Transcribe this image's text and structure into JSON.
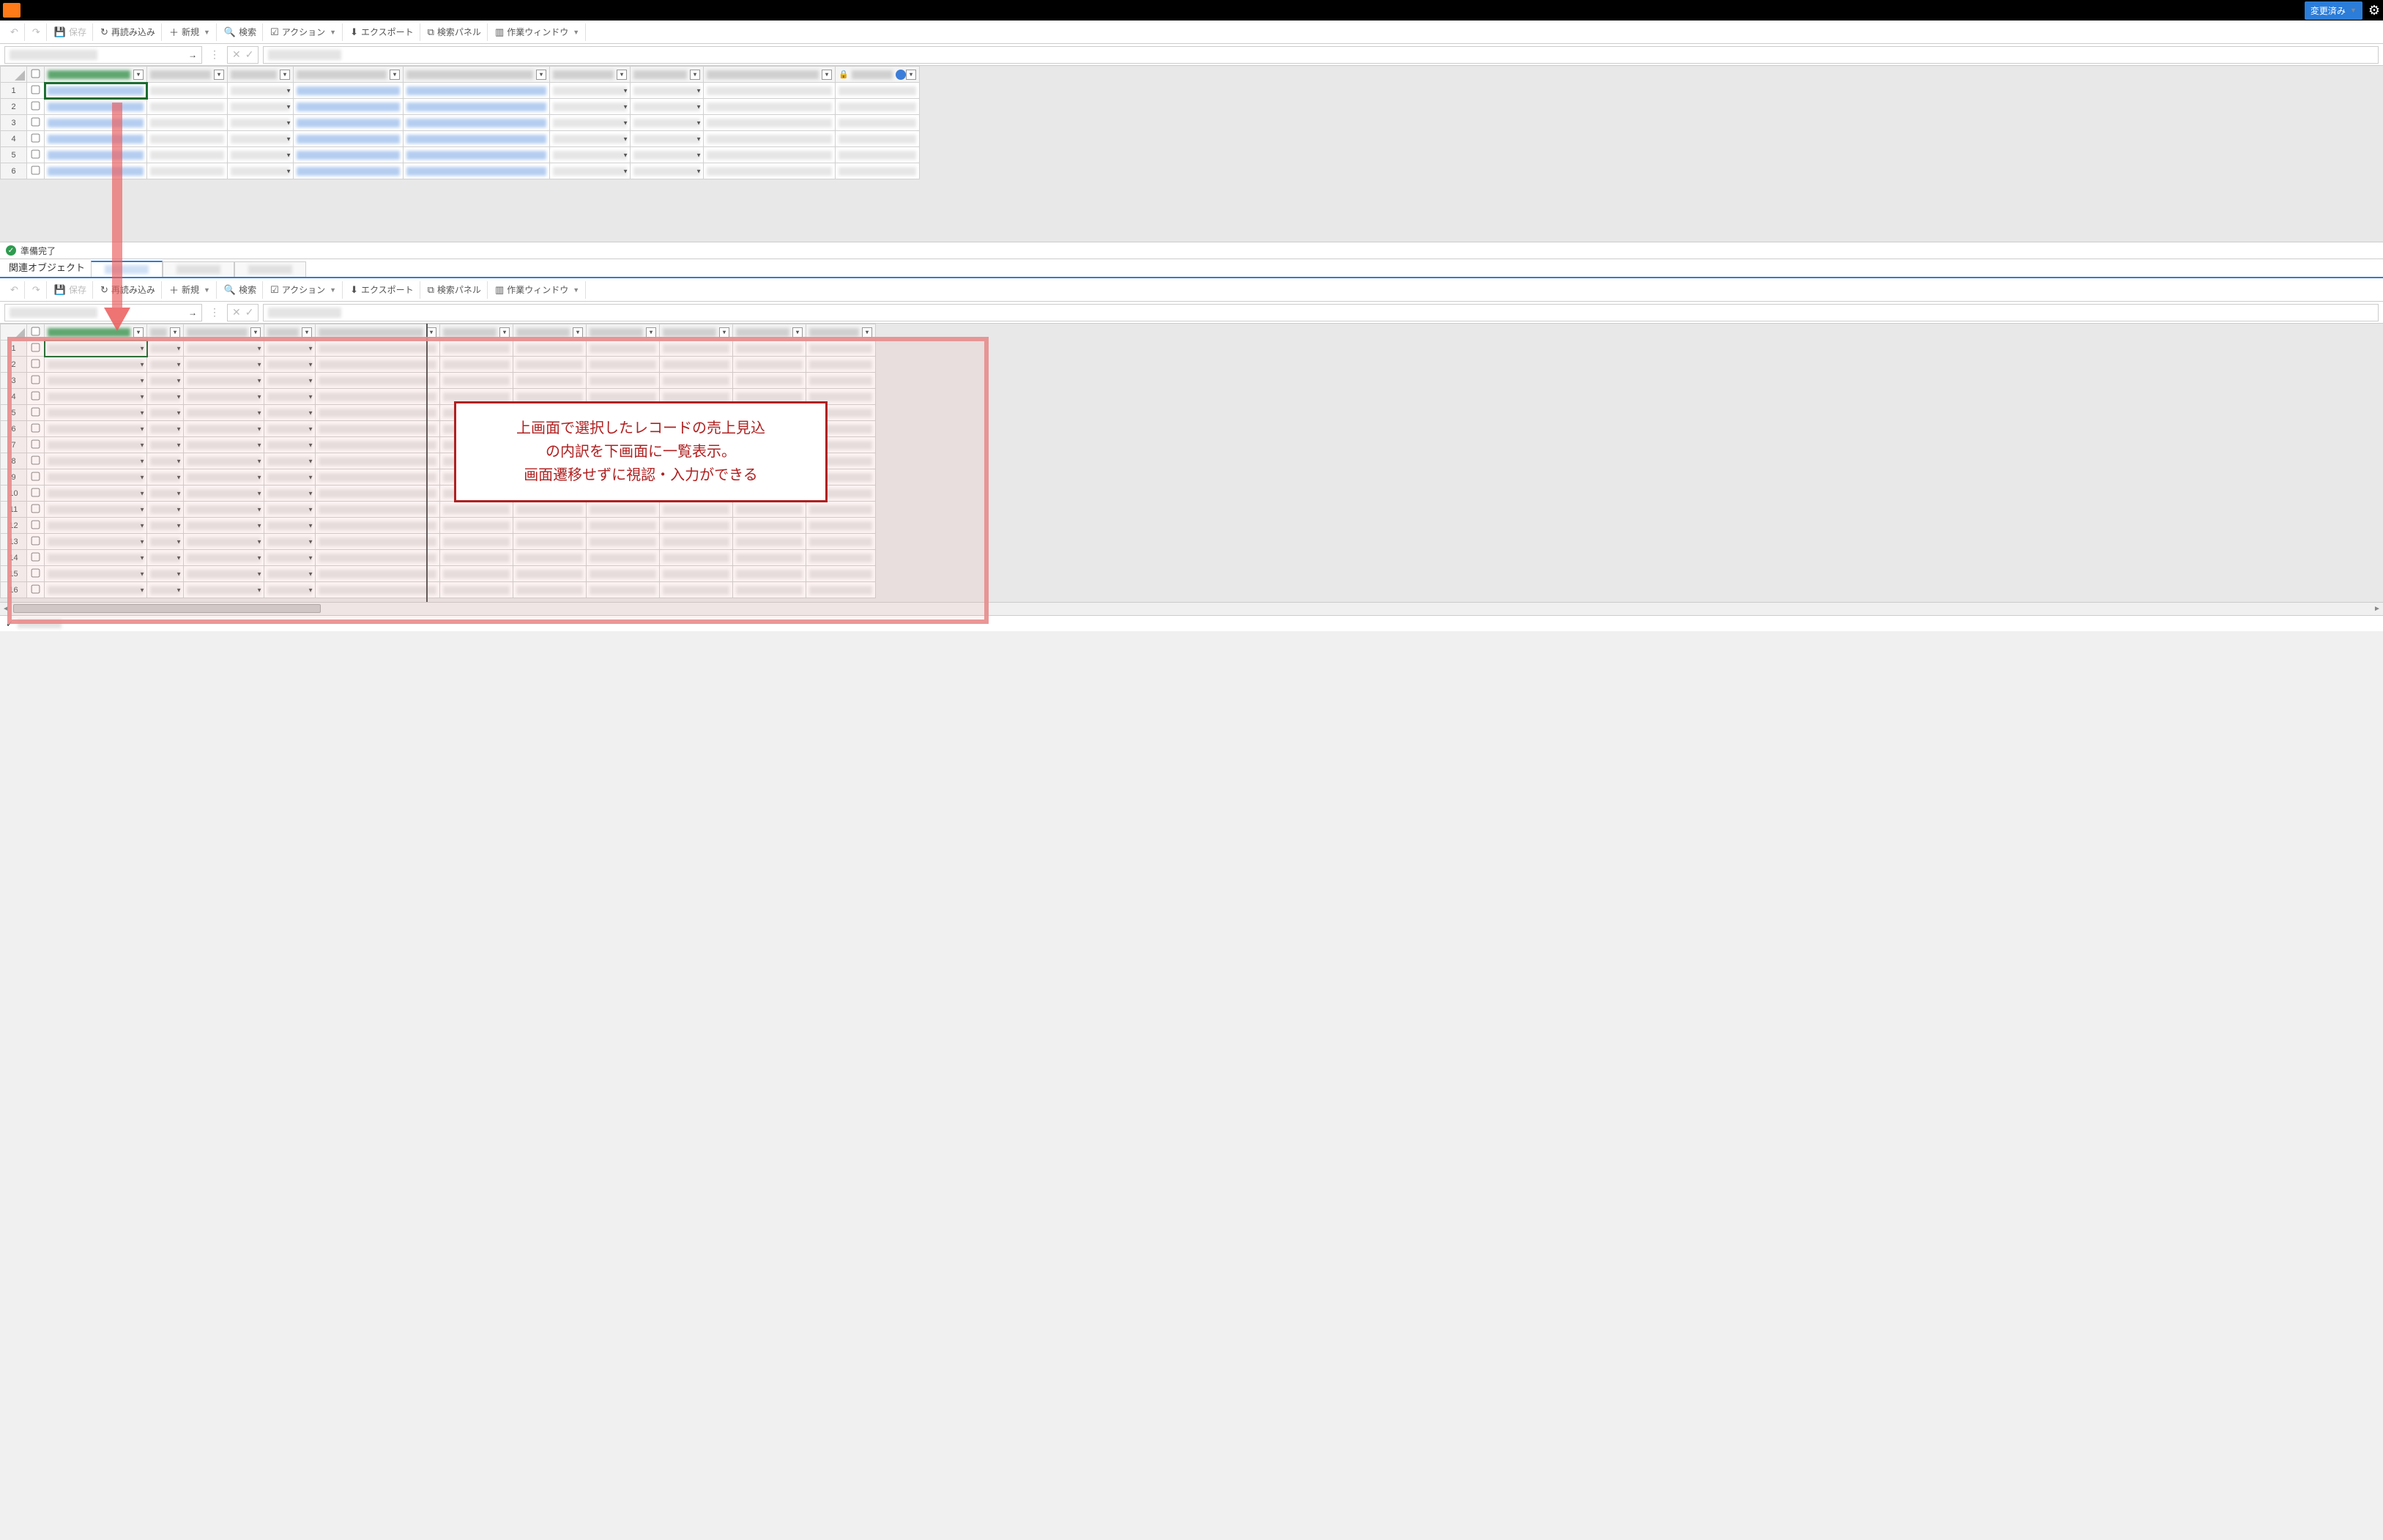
{
  "titlebar": {
    "changed_label": "変更済み"
  },
  "toolbar": {
    "save": "保存",
    "reload": "再読み込み",
    "new": "新規",
    "search": "検索",
    "action": "アクション",
    "export": "エクスポート",
    "search_panel": "検索パネル",
    "work_window": "作業ウィンドウ"
  },
  "status": {
    "ready": "準備完了"
  },
  "related": {
    "label": "関連オブジェクト"
  },
  "callout": {
    "line1": "上画面で選択したレコードの売上見込",
    "line2": "の内訳を下画面に一覧表示。",
    "line3": "画面遷移せずに視認・入力ができる"
  },
  "top_grid": {
    "rows": [
      1,
      2,
      3,
      4,
      5,
      6
    ],
    "col_count": 9,
    "dropdown_cols": [
      2,
      5,
      6
    ],
    "blue_cols": [
      0,
      3,
      4
    ]
  },
  "bottom_grid": {
    "rows": [
      1,
      2,
      3,
      4,
      5,
      6,
      7,
      8,
      9,
      10,
      11,
      12,
      13,
      14,
      15,
      16
    ],
    "col_count": 11,
    "dropdown_cols": [
      0,
      1,
      2,
      3
    ]
  },
  "icons": {
    "undo": "↶",
    "redo": "↷",
    "save": "💾",
    "reload": "↻",
    "plus": "＋",
    "search": "🔍",
    "action": "☑",
    "export": "⬇",
    "panel": "⧉",
    "window": "▥",
    "caret": "▼",
    "arrow_right": "→",
    "x": "✕",
    "check": "✓",
    "lock": "🔒",
    "gear": "⚙",
    "filter": "▾",
    "ok": "✓"
  }
}
